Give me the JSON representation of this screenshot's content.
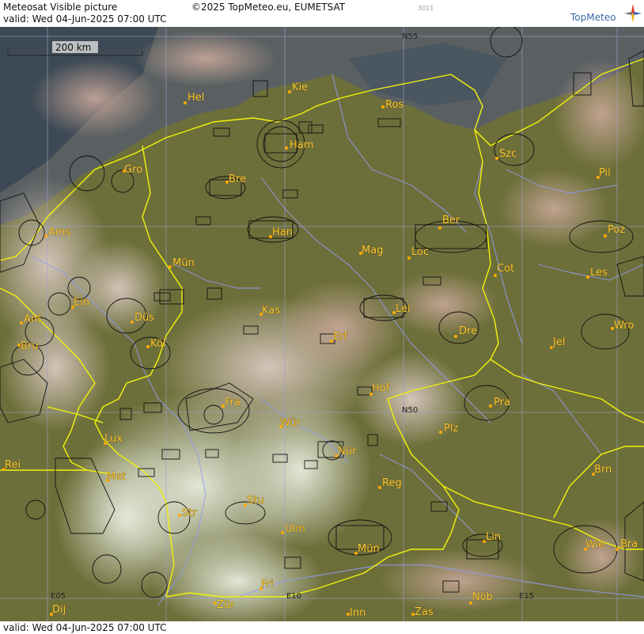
{
  "header": {
    "product": "Meteosat Visible picture",
    "valid": "valid:  Wed  04-Jun-2025  07:00 UTC",
    "copyright": "©2025 TopMeteo.eu, EUMETSAT",
    "code": "3011",
    "logo_text": "TopMeteo",
    "logo_icon": "compass-star-icon"
  },
  "footer": {
    "valid": "valid:  Wed  04-Jun-2025  07:00 UTC"
  },
  "map": {
    "scale_label": "200 km",
    "grid_labels": {
      "n55": "N55",
      "n50": "N50",
      "e05": "E05",
      "e10": "E10",
      "e15": "E15"
    },
    "colors": {
      "border": "#f2f20a",
      "river": "#8f9cf0",
      "graticule": "#9aa0c8",
      "airspace": "#111111",
      "city_label": "#ffcc33",
      "city_dot": "#ffaa00"
    },
    "cities": {
      "hel": "Hel",
      "kie": "Kie",
      "ros": "Ros",
      "ham": "Ham",
      "szc": "Szc",
      "gro": "Gro",
      "bre": "Bre",
      "pil": "Pil",
      "ber": "Ber",
      "poz": "Poz",
      "ams": "Ams",
      "han": "Han",
      "mag": "Mag",
      "loc": "Loc",
      "mun": "Mün",
      "cot": "Cot",
      "les": "Les",
      "ein": "Ein",
      "kas": "Kas",
      "lei": "Lei",
      "ant": "Ant",
      "dus": "Düs",
      "wro": "Wro",
      "bru": "Bru",
      "erf": "Erf",
      "dre": "Dre",
      "kol": "Köl",
      "jel": "Jel",
      "hof": "Hof",
      "fra": "Fra",
      "pra": "Pra",
      "wur": "Wür",
      "plz": "Plz",
      "lux": "Lux",
      "nur": "Nür",
      "rei": "Rei",
      "met": "Met",
      "brn": "Brn",
      "reg": "Reg",
      "stu": "Stu",
      "str": "Str",
      "ulm": "Ulm",
      "lin": "Lin",
      "mue": "Mün",
      "wie": "Wie",
      "bra": "Bra",
      "fri": "Fri",
      "nob": "Nöb",
      "dij": "Dij",
      "zur": "Zür",
      "inn": "Inn",
      "zas": "Zas"
    }
  }
}
